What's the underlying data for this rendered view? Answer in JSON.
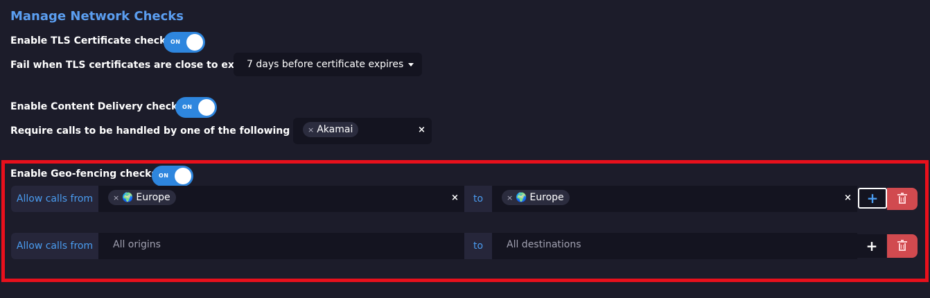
{
  "header": {
    "title": "Manage Network Checks"
  },
  "tls": {
    "enable_label": "Enable TLS Certificate checks:",
    "toggle_text": "ON",
    "expiry_label": "Fail when TLS certificates are close to expiry:",
    "expiry_value": "7 days before certificate expires"
  },
  "cdn": {
    "enable_label": "Enable Content Delivery checks:",
    "toggle_text": "ON",
    "require_label": "Require calls to be handled by one of the following CDNs:",
    "selected": [
      "Akamai"
    ],
    "clear_symbol": "×"
  },
  "geo": {
    "enable_label": "Enable Geo-fencing checks:",
    "toggle_text": "ON",
    "rows": [
      {
        "from_label": "Allow calls from",
        "origin_chip": "Europe",
        "to_label": "to",
        "destination_chip": "Europe",
        "add_symbol": "+",
        "clear_symbol": "×"
      },
      {
        "from_label": "Allow calls from",
        "origin_placeholder": "All origins",
        "to_label": "to",
        "destination_placeholder": "All destinations",
        "add_symbol": "+"
      }
    ],
    "chip_remove_symbol": "×",
    "globe_glyph": "🌍"
  },
  "colors": {
    "background": "#1c1c2a",
    "accent": "#2e86de",
    "title": "#5b9ef0",
    "danger": "#d14a4f",
    "highlight": "#e8101c"
  },
  "icons": {
    "add": "plus-icon",
    "delete": "trash-icon",
    "remove": "close-icon",
    "region": "globe-icon"
  }
}
